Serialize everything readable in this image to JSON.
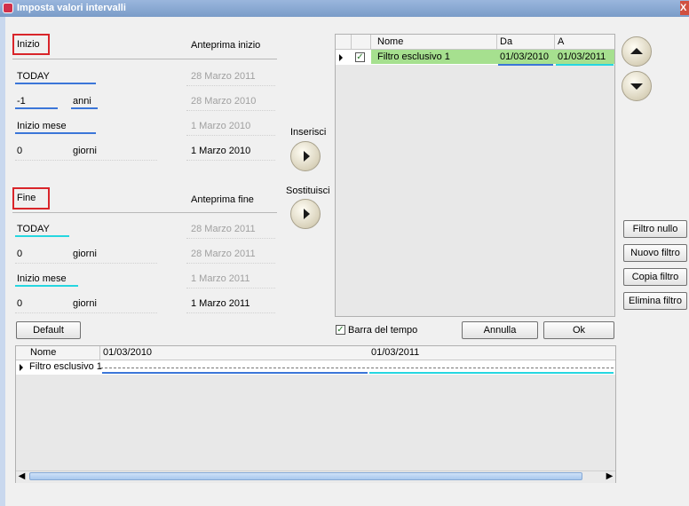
{
  "window": {
    "title": "Imposta valori intervalli",
    "close_glyph": "X"
  },
  "start": {
    "header": "Inizio",
    "preview_header": "Anteprima inizio",
    "rows": [
      {
        "value": "TODAY",
        "unit": "",
        "preview": "28 Marzo 2011"
      },
      {
        "value": "-1",
        "unit": "anni",
        "preview": "28 Marzo 2010"
      },
      {
        "value": "Inizio mese",
        "unit": "",
        "preview": "1 Marzo 2010"
      },
      {
        "value": "0",
        "unit": "giorni",
        "preview": "1 Marzo 2010"
      }
    ]
  },
  "end": {
    "header": "Fine",
    "preview_header": "Anteprima fine",
    "rows": [
      {
        "value": "TODAY",
        "unit": "",
        "preview": "28 Marzo 2011"
      },
      {
        "value": "0",
        "unit": "giorni",
        "preview": "28 Marzo 2011"
      },
      {
        "value": "Inizio mese",
        "unit": "",
        "preview": "1 Marzo 2011"
      },
      {
        "value": "0",
        "unit": "giorni",
        "preview": "1 Marzo 2011"
      }
    ]
  },
  "actions": {
    "insert_label": "Inserisci",
    "replace_label": "Sostituisci"
  },
  "filter_grid": {
    "columns": [
      "Nome",
      "Da",
      "A"
    ],
    "rows": [
      {
        "checked": true,
        "name": "Filtro esclusivo 1",
        "from": "01/03/2010",
        "to": "01/03/2011"
      }
    ]
  },
  "side_buttons": [
    "Filtro nullo",
    "Nuovo filtro",
    "Copia filtro",
    "Elimina filtro"
  ],
  "bottom_bar": {
    "default_label": "Default",
    "timebar_checked": true,
    "timebar_label": "Barra del tempo",
    "cancel_label": "Annulla",
    "ok_label": "Ok"
  },
  "timeline": {
    "name_header": "Nome",
    "ticks": [
      "01/03/2010",
      "01/03/2011"
    ],
    "rows": [
      {
        "name": "Filtro esclusivo 1"
      }
    ]
  },
  "colors": {
    "start_accent": "#3b76d8",
    "end_accent": "#26d6e0",
    "selected_row": "#a6e08f",
    "highlight_box": "#d9252a"
  },
  "icons": {
    "move_up": "chevron-up-icon",
    "move_down": "chevron-down-icon",
    "insert": "play-icon",
    "replace": "play-icon"
  }
}
